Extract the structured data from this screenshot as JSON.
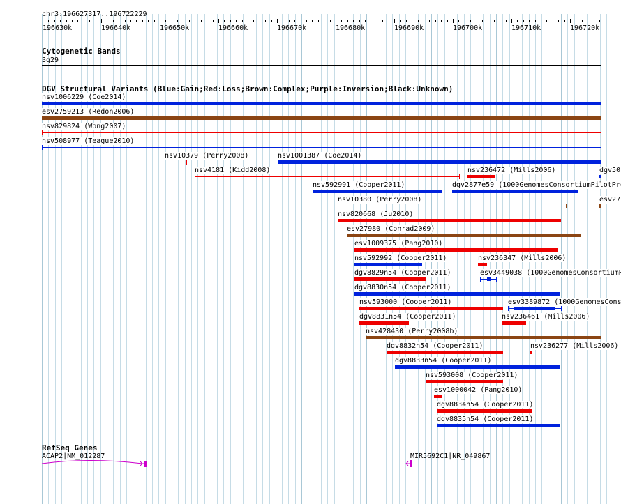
{
  "ruler": {
    "position": "chr3:196627317..196722229",
    "ticks": [
      "196630k",
      "196640k",
      "196650k",
      "196660k",
      "196670k",
      "196680k",
      "196690k",
      "196700k",
      "196710k",
      "196720k"
    ]
  },
  "cytoband": {
    "title": "Cytogenetic Bands",
    "band": "3q29"
  },
  "dgv": {
    "title": "DGV Structural Variants (Blue:Gain;Red:Loss;Brown:Complex;Purple:Inversion;Black:Unknown)",
    "colors": {
      "gain": "#0022dd",
      "loss": "#ee0000",
      "complex": "#8b4513"
    },
    "features": [
      {
        "label": "nsv1006229 (Coe2014)",
        "type": "gain",
        "style": "thick"
      },
      {
        "label": "esv2759213 (Redon2006)",
        "type": "complex",
        "style": "thick"
      },
      {
        "label": "nsv829824 (Wong2007)",
        "type": "loss",
        "style": "thin"
      },
      {
        "label": "nsv508977 (Teague2010)",
        "type": "gain",
        "style": "thin"
      },
      {
        "label": "nsv10379 (Perry2008)",
        "type": "loss",
        "style": "thin"
      },
      {
        "label": "nsv1001387 (Coe2014)",
        "type": "gain",
        "style": "thick"
      },
      {
        "label": "nsv4181 (Kidd2008)",
        "type": "loss",
        "style": "thin"
      },
      {
        "label": "nsv236472 (Mills2006)",
        "type": "loss",
        "style": "thick"
      },
      {
        "label": "dgv50",
        "type": "gain",
        "style": "thick"
      },
      {
        "label": "nsv592991 (Cooper2011)",
        "type": "gain",
        "style": "thick"
      },
      {
        "label": "dgv2877e59 (1000GenomesConsortiumPilotPro",
        "type": "gain",
        "style": "thick"
      },
      {
        "label": "nsv10380 (Perry2008)",
        "type": "complex",
        "style": "thin"
      },
      {
        "label": "esv27",
        "type": "complex",
        "style": "thick"
      },
      {
        "label": "nsv820668 (Ju2010)",
        "type": "loss",
        "style": "thick"
      },
      {
        "label": "esv27980 (Conrad2009)",
        "type": "complex",
        "style": "thick"
      },
      {
        "label": "esv1009375 (Pang2010)",
        "type": "loss",
        "style": "thick"
      },
      {
        "label": "nsv592992 (Cooper2011)",
        "type": "gain",
        "style": "thick"
      },
      {
        "label": "nsv236347 (Mills2006)",
        "type": "loss",
        "style": "thick"
      },
      {
        "label": "dgv8829n54 (Cooper2011)",
        "type": "loss",
        "style": "thick"
      },
      {
        "label": "esv3449038 (1000GenomesConsortiumP",
        "type": "gain",
        "style": "thin"
      },
      {
        "label": "dgv8830n54 (Cooper2011)",
        "type": "gain",
        "style": "thick"
      },
      {
        "label": "nsv593000 (Cooper2011)",
        "type": "loss",
        "style": "thick"
      },
      {
        "label": "esv3389872 (1000GenomesCons",
        "type": "gain",
        "style": "thin"
      },
      {
        "label": "dgv8831n54 (Cooper2011)",
        "type": "loss",
        "style": "thick"
      },
      {
        "label": "nsv236461 (Mills2006)",
        "type": "loss",
        "style": "thick"
      },
      {
        "label": "nsv428430 (Perry2008b)",
        "type": "complex",
        "style": "thick"
      },
      {
        "label": "dgv8832n54 (Cooper2011)",
        "type": "loss",
        "style": "thick"
      },
      {
        "label": "nsv236277 (Mills2006)",
        "type": "loss",
        "style": "thick"
      },
      {
        "label": "dgv8833n54 (Cooper2011)",
        "type": "gain",
        "style": "thick"
      },
      {
        "label": "nsv593008 (Cooper2011)",
        "type": "loss",
        "style": "thick"
      },
      {
        "label": "esv1000042 (Pang2010)",
        "type": "loss",
        "style": "thick"
      },
      {
        "label": "dgv8834n54 (Cooper2011)",
        "type": "loss",
        "style": "thick"
      },
      {
        "label": "dgv8835n54 (Cooper2011)",
        "type": "gain",
        "style": "thick"
      }
    ]
  },
  "refseq": {
    "title": "RefSeq Genes",
    "color": "#cc00cc",
    "genes": [
      {
        "label": "ACAP2|NM_012287"
      },
      {
        "label": "MIR5692C1|NR_049867"
      }
    ]
  }
}
